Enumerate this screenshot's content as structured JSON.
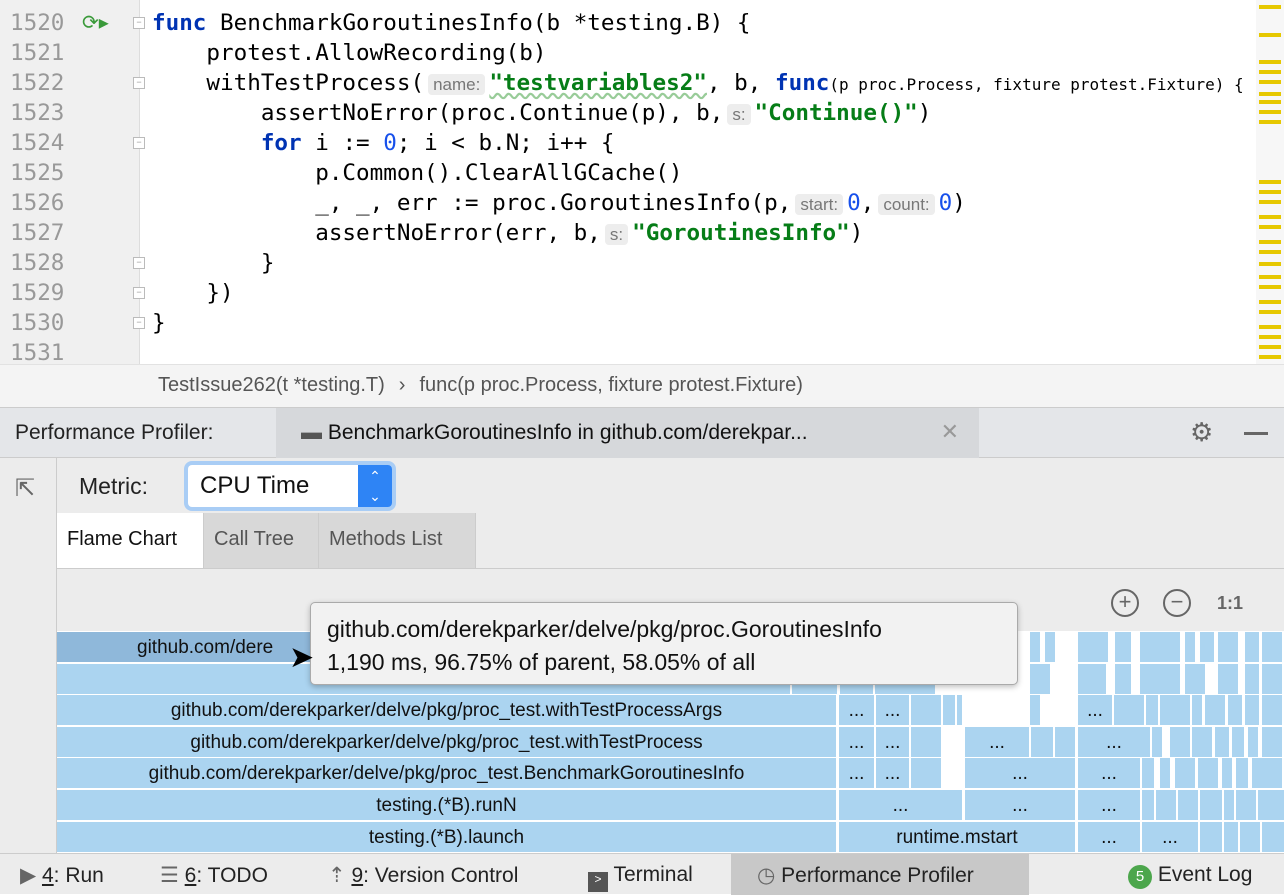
{
  "editor": {
    "line_numbers": [
      "1520",
      "1521",
      "1522",
      "1523",
      "1524",
      "1525",
      "1526",
      "1527",
      "1528",
      "1529",
      "1530",
      "1531"
    ],
    "lines": {
      "l1520": {
        "kw": "func",
        "rest": " BenchmarkGoroutinesInfo(b *testing.B) {"
      },
      "l1521": "    protest.AllowRecording(b)",
      "l1522": {
        "a": "    withTestProcess(",
        "hint": "name:",
        "str": "\"testvariables2\"",
        "b": ", b, ",
        "kw": "func",
        "c": "(p proc.Process, fixture protest.Fixture) {"
      },
      "l1523": {
        "a": "        assertNoError(proc.Continue(p), b,",
        "hint": "s:",
        "str": "\"Continue()\"",
        "b": ")"
      },
      "l1524": {
        "kw": "for",
        "a": " i := ",
        "num": "0",
        "b": "; i < b.N; i++ {"
      },
      "l1525": "            p.Common().ClearAllGCache()",
      "l1526": {
        "a": "            _, _, err := proc.GoroutinesInfo(p,",
        "hint1": "start:",
        "num1": "0",
        "sep": ",",
        "hint2": "count:",
        "num2": "0",
        "b": ")"
      },
      "l1527": {
        "a": "            assertNoError(err, b,",
        "hint": "s:",
        "str": "\"GoroutinesInfo\"",
        "b": ")"
      },
      "l1528": "        }",
      "l1529": "    })",
      "l1530": "}"
    }
  },
  "breadcrumbs": [
    "TestIssue262(t *testing.T)",
    "›",
    "func(p proc.Process, fixture protest.Fixture)"
  ],
  "profiler": {
    "title": "Performance Profiler:",
    "tab_label": "BenchmarkGoroutinesInfo in github.com/derekpar...",
    "metric_label": "Metric:",
    "metric_value": "CPU Time",
    "tabs": [
      "Flame Chart",
      "Call Tree",
      "Methods List"
    ],
    "zoom_reset": "1:1"
  },
  "flame": {
    "labels": {
      "r0": "github.com/dere",
      "r2": "github.com/derekparker/delve/pkg/proc_test.withTestProcessArgs",
      "r3": "github.com/derekparker/delve/pkg/proc_test.withTestProcess",
      "r4": "github.com/derekparker/delve/pkg/proc_test.BenchmarkGoroutinesInfo",
      "r5": "testing.(*B).runN",
      "r6": "testing.(*B).launch",
      "mstart": "runtime.mstart",
      "ellipsis": "..."
    },
    "tooltip": {
      "title": "github.com/derekparker/delve/pkg/proc.GoroutinesInfo",
      "stats": "1,190 ms, 96.75% of parent, 58.05% of all"
    }
  },
  "status_bar": [
    {
      "key": "4",
      "label": ": Run"
    },
    {
      "key": "6",
      "label": ": TODO"
    },
    {
      "key": "9",
      "label": ": Version Control"
    },
    {
      "key": "",
      "label": "Terminal"
    },
    {
      "key": "",
      "label": "Performance Profiler"
    },
    {
      "badge": "5",
      "label": "Event Log"
    }
  ]
}
